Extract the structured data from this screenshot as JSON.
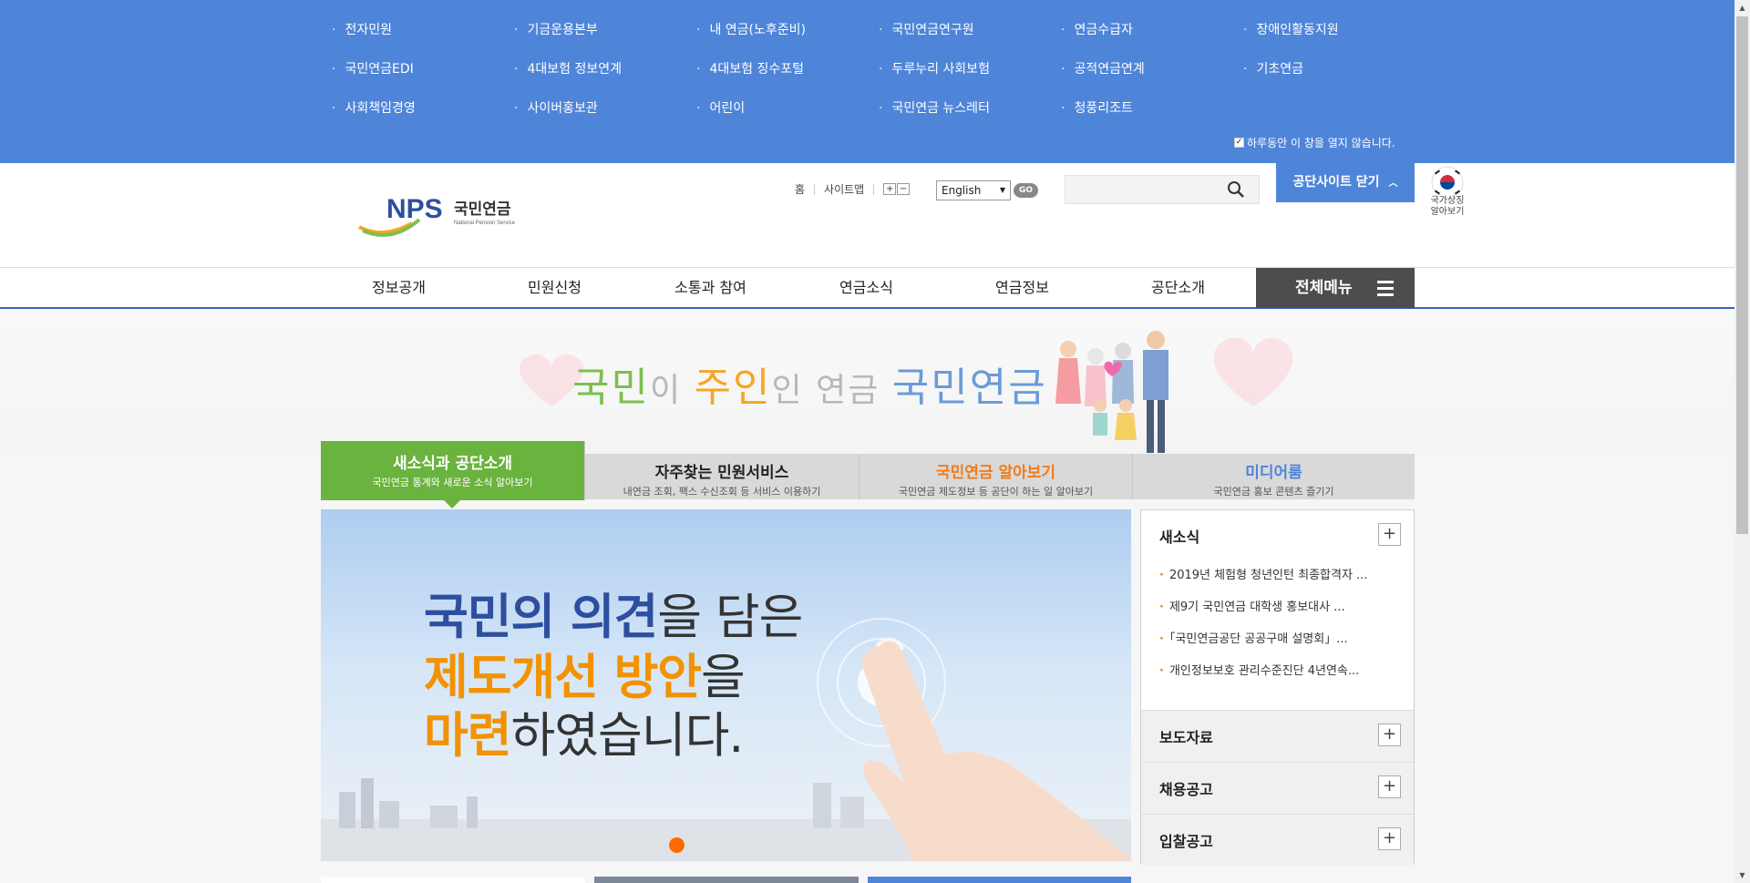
{
  "site_panel": {
    "links": [
      "전자민원",
      "기금운용본부",
      "내 연금(노후준비)",
      "국민연금연구원",
      "연금수급자",
      "장애인활동지원",
      "국민연금EDI",
      "4대보험 정보연계",
      "4대보험 징수포털",
      "두루누리 사회보험",
      "공적연금연계",
      "기초연금",
      "사회책임경영",
      "사이버홍보관",
      "어린이",
      "국민연금 뉴스레터",
      "청풍리조트"
    ],
    "no_show_label": "하루동안 이 창을 열지 않습니다."
  },
  "header": {
    "logo_text": "NPS",
    "logo_kor": "국민연금",
    "logo_eng": "National Pension Service",
    "util": {
      "home": "홈",
      "sitemap": "사이트맵",
      "zoom_in": "+",
      "zoom_out": "−"
    },
    "language": "English",
    "go_label": "GO",
    "search_placeholder": "",
    "close_sites_label": "공단사이트 닫기",
    "flag_label_1": "국가상징",
    "flag_label_2": "알아보기"
  },
  "gnb": {
    "items": [
      "정보공개",
      "민원신청",
      "소통과 참여",
      "연금소식",
      "연금정보",
      "공단소개"
    ],
    "all_menu": "전체메뉴"
  },
  "banner": {
    "slogan_parts": [
      "국민",
      "이 ",
      "주인",
      "인 연금 ",
      "국민연금"
    ]
  },
  "tabs": [
    {
      "title": "새소식과 공단소개",
      "sub": "국민연금 통계와 새로운 소식 알아보기"
    },
    {
      "title": "자주찾는 민원서비스",
      "sub": "내연금 조회, 팩스 수신조회 등 서비스 이용하기"
    },
    {
      "title": "국민연금 알아보기",
      "sub": "국민연금 제도정보 등 공단이 하는 일 알아보기"
    },
    {
      "title": "미디어룸",
      "sub": "국민연금 홍보 콘텐츠 즐기기"
    }
  ],
  "visual": {
    "line1_strong": "국민의 의견",
    "line1_light": "을 담은",
    "line2_strong": "제도개선 방안",
    "line2_light": "을",
    "line3_strong": "마련",
    "line3_light": "하였습니다."
  },
  "news": {
    "heading": "새소식",
    "items": [
      "2019년 체험형 청년인턴 최종합격자 ...",
      "제9기 국민연금 대학생 홍보대사 ...",
      "「국민연금공단 공공구매 설명회」...",
      "개인정보보호 관리수준진단 4년연속..."
    ],
    "press": "보도자료",
    "jobs": "채용공고",
    "bids": "입찰공고",
    "more": "+"
  },
  "colors": {
    "brand_blue": "#4f85d9",
    "accent_green": "#6ab33e",
    "accent_orange": "#f07c1a"
  }
}
